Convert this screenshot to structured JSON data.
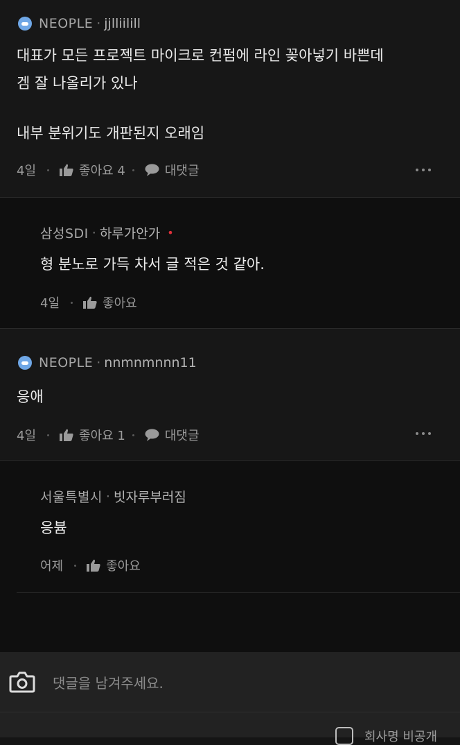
{
  "comments": [
    {
      "company": "NEOPLE",
      "nickname": "jjlliilill",
      "lines": [
        "대표가 모든 프로젝트 마이크로 컨펌에 라인 꽂아넣기 바쁜데",
        "겜 잘 나올리가 있나",
        "",
        "내부 분위기도 개판된지 오래임"
      ],
      "time": "4일",
      "like_label": "좋아요 4",
      "reply_label": "대댓글"
    },
    {
      "company": "삼성SDI",
      "nickname": "하루가안가",
      "lines": [
        "형 분노로 가득 차서 글 적은 것 같아."
      ],
      "time": "4일",
      "like_label": "좋아요"
    },
    {
      "company": "NEOPLE",
      "nickname": "nnmnmnnn11",
      "lines": [
        "응애"
      ],
      "time": "4일",
      "like_label": "좋아요 1",
      "reply_label": "대댓글"
    },
    {
      "company": "서울특별시",
      "nickname": "빗자루부러짐",
      "lines": [
        "응븀"
      ],
      "time": "어제",
      "like_label": "좋아요"
    }
  ],
  "input": {
    "placeholder": "댓글을 남겨주세요.",
    "anonymous_label": "회사명 비공개"
  },
  "colors": {
    "background": "#151515",
    "badge": "#6fa7e6",
    "new_dot": "#e0303a"
  }
}
